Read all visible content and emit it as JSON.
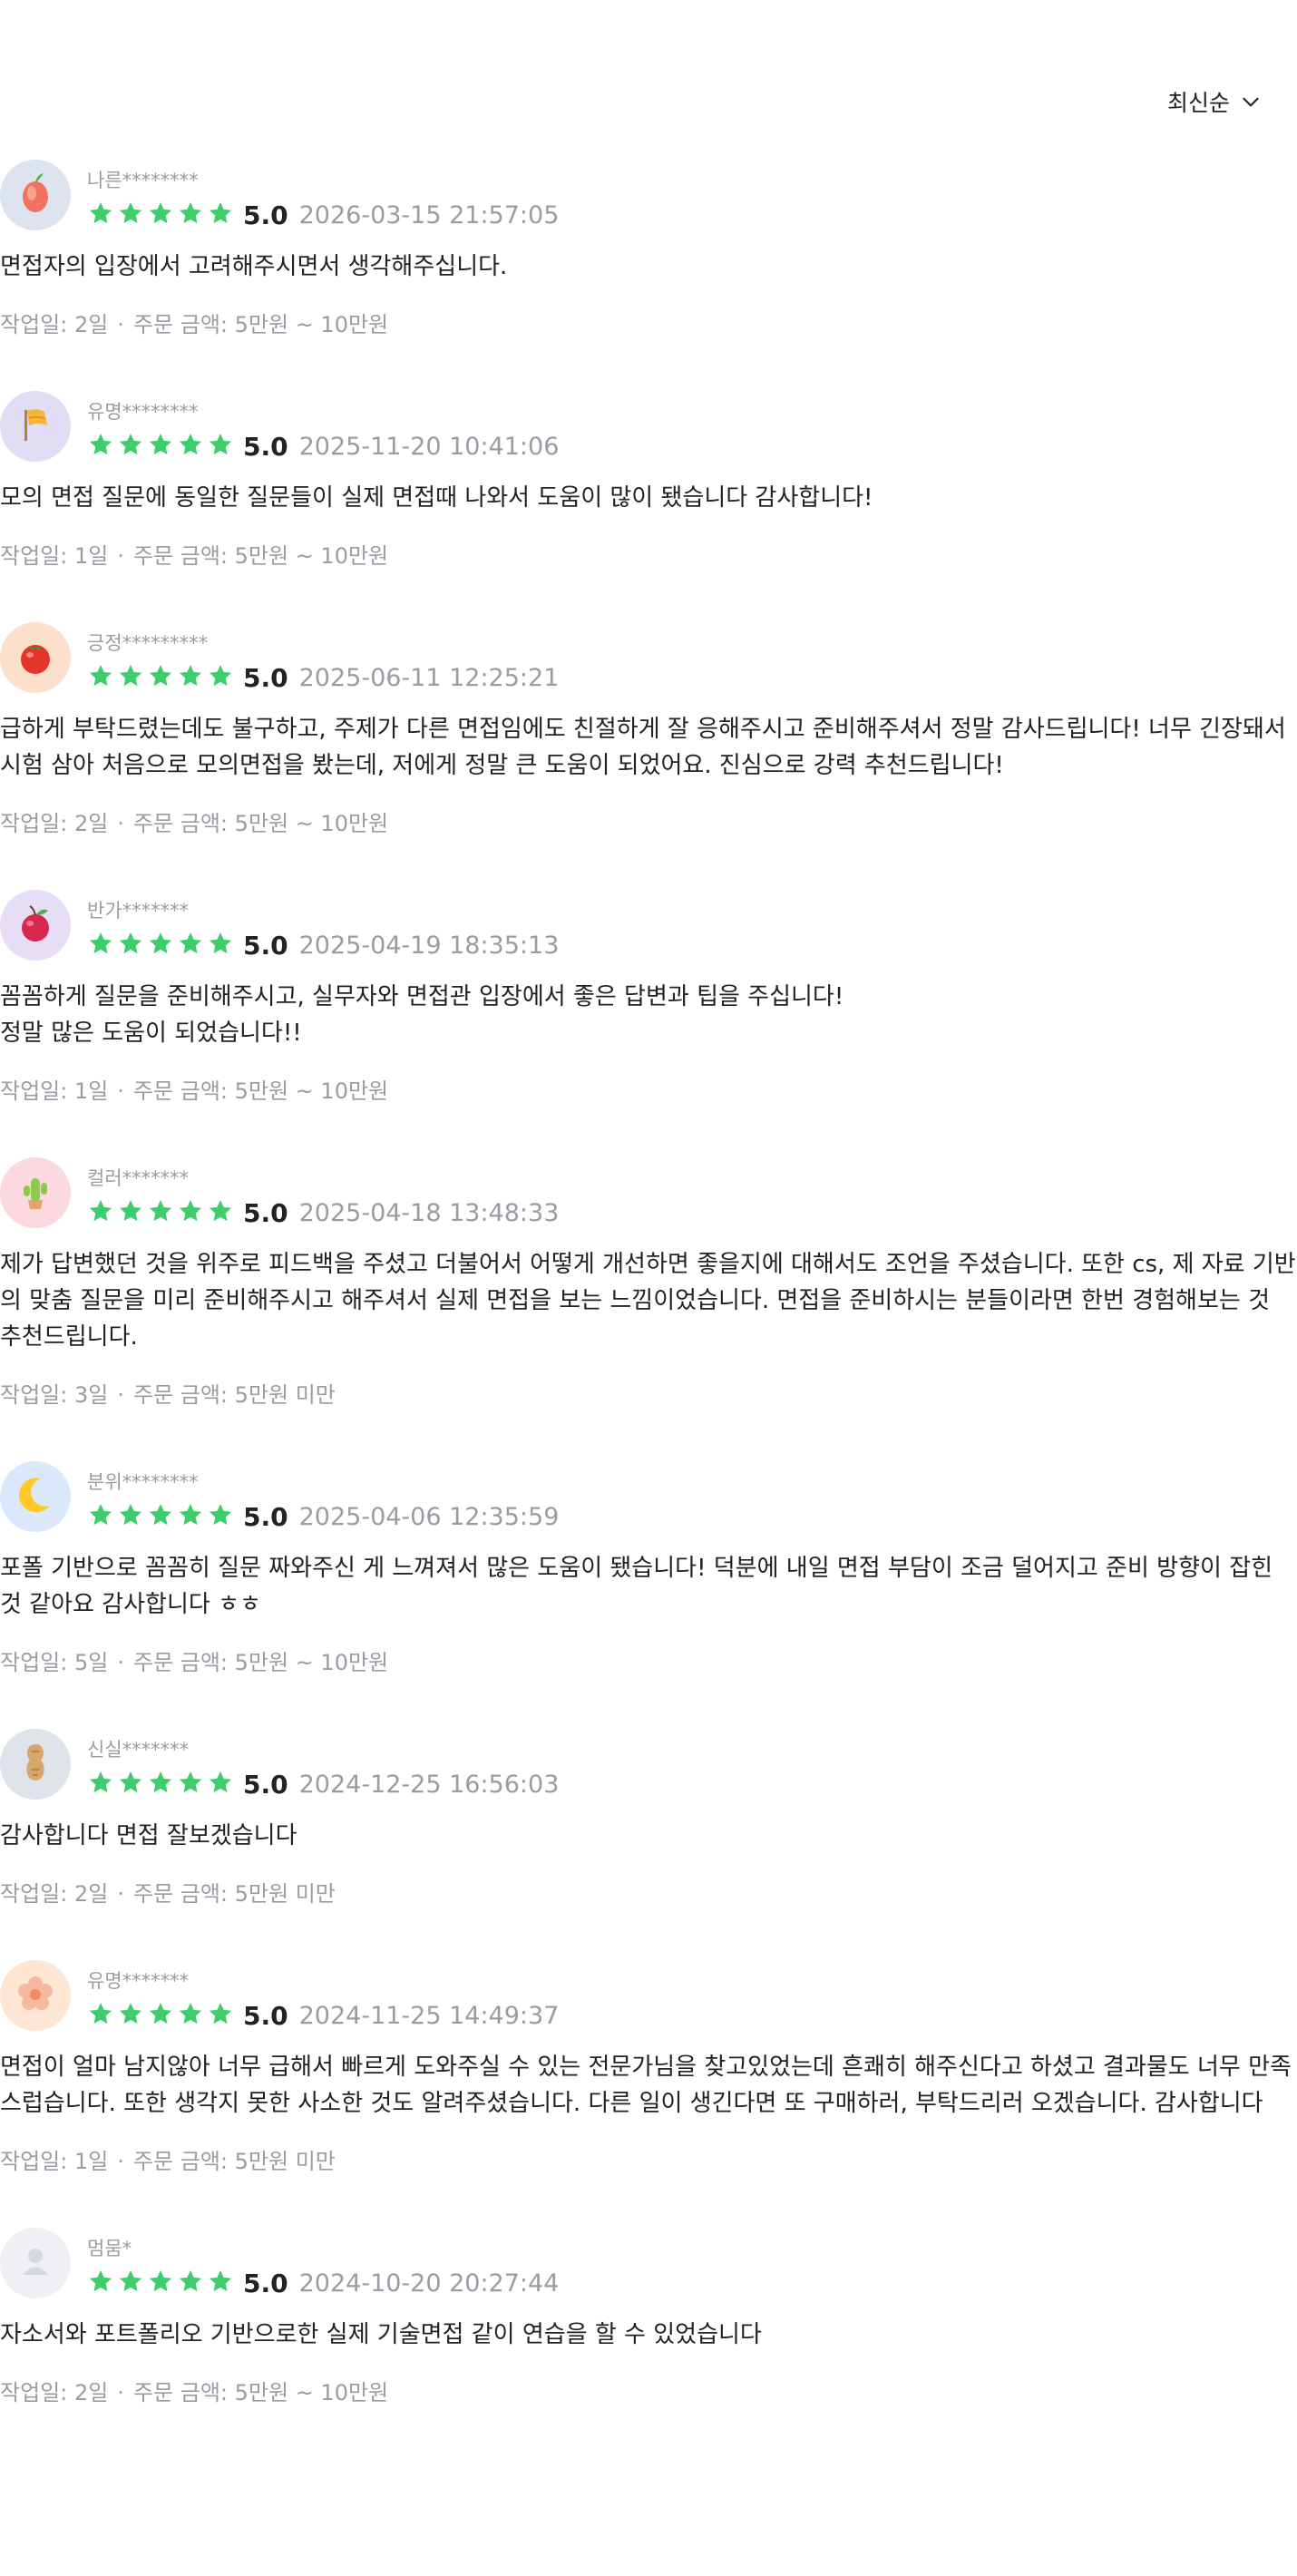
{
  "sort": {
    "label": "최신순"
  },
  "colors": {
    "star": "#3ecd6b",
    "muted": "#9a9ca3",
    "text": "#212224"
  },
  "labels": {
    "worktime_prefix": "작업일: ",
    "price_prefix": "주문 금액: ",
    "separator": "·"
  },
  "reviews": [
    {
      "avatar_icon": "guava-icon",
      "avatar_bg": "#dde4ef",
      "user": "나른********",
      "rating": "5.0",
      "stars": 5,
      "date": "2026-03-15 21:57:05",
      "text": "면접자의 입장에서 고려해주시면서 생각해주십니다.",
      "worktime": "2일",
      "price": "5만원 ~ 10만원"
    },
    {
      "avatar_icon": "flag-icon",
      "avatar_bg": "#e3dcf5",
      "user": "유명********",
      "rating": "5.0",
      "stars": 5,
      "date": "2025-11-20 10:41:06",
      "text": "모의 면접 질문에 동일한 질문들이 실제 면접때 나와서 도움이 많이 됐습니다 감사합니다!",
      "worktime": "1일",
      "price": "5만원 ~ 10만원"
    },
    {
      "avatar_icon": "tomato-icon",
      "avatar_bg": "#fde0cc",
      "user": "긍정*********",
      "rating": "5.0",
      "stars": 5,
      "date": "2025-06-11 12:25:21",
      "text": "급하게 부탁드렸는데도 불구하고, 주제가 다른 면접임에도 친절하게 잘 응해주시고 준비해주셔서 정말 감사드립니다! 너무 긴장돼서 시험 삼아 처음으로 모의면접을 봤는데, 저에게 정말 큰 도움이 되었어요. 진심으로 강력 추천드립니다!",
      "worktime": "2일",
      "price": "5만원 ~ 10만원"
    },
    {
      "avatar_icon": "apple-icon",
      "avatar_bg": "#e6ddf6",
      "user": "반가*******",
      "rating": "5.0",
      "stars": 5,
      "date": "2025-04-19 18:35:13",
      "text": "꼼꼼하게 질문을 준비해주시고, 실무자와 면접관 입장에서 좋은 답변과 팁을 주십니다!\n정말 많은 도움이 되었습니다!!",
      "worktime": "1일",
      "price": "5만원 ~ 10만원"
    },
    {
      "avatar_icon": "cactus-icon",
      "avatar_bg": "#fbd9de",
      "user": "컬러*******",
      "rating": "5.0",
      "stars": 5,
      "date": "2025-04-18 13:48:33",
      "text": "제가 답변했던 것을 위주로 피드백을 주셨고 더불어서 어떻게 개선하면 좋을지에 대해서도 조언을 주셨습니다. 또한 cs, 제 자료 기반의 맞춤 질문을 미리 준비해주시고 해주셔서 실제 면접을 보는 느낌이었습니다. 면접을 준비하시는 분들이라면 한번 경험해보는 것 추천드립니다.",
      "worktime": "3일",
      "price": "5만원 미만"
    },
    {
      "avatar_icon": "moon-icon",
      "avatar_bg": "#dbe8fb",
      "user": "분위********",
      "rating": "5.0",
      "stars": 5,
      "date": "2025-04-06 12:35:59",
      "text": "포폴 기반으로 꼼꼼히 질문 짜와주신 게 느껴져서 많은 도움이 됐습니다! 덕분에 내일 면접 부담이 조금 덜어지고 준비 방향이 잡힌 것 같아요 감사합니다 ㅎㅎ",
      "worktime": "5일",
      "price": "5만원 ~ 10만원"
    },
    {
      "avatar_icon": "peanut-icon",
      "avatar_bg": "#dfe3ea",
      "user": "신실*******",
      "rating": "5.0",
      "stars": 5,
      "date": "2024-12-25 16:56:03",
      "text": "감사합니다 면접 잘보겠습니다",
      "worktime": "2일",
      "price": "5만원 미만"
    },
    {
      "avatar_icon": "flower-icon",
      "avatar_bg": "#fde6d4",
      "user": "유명*******",
      "rating": "5.0",
      "stars": 5,
      "date": "2024-11-25 14:49:37",
      "text": "면접이 얼마 남지않아 너무 급해서 빠르게 도와주실 수 있는 전문가님을 찾고있었는데 흔쾌히 해주신다고 하셨고 결과물도 너무 만족스럽습니다. 또한 생각지 못한  사소한 것도 알려주셨습니다. 다른 일이 생긴다면 또 구매하러, 부탁드리러 오겠습니다. 감사합니다",
      "worktime": "1일",
      "price": "5만원 미만"
    },
    {
      "avatar_icon": "default-user-icon",
      "avatar_bg": "#eef0f4",
      "user": "멈뭄*",
      "rating": "5.0",
      "stars": 5,
      "date": "2024-10-20 20:27:44",
      "text": "자소서와 포트폴리오 기반으로한 실제 기술면접 같이 연습을 할 수 있었습니다",
      "worktime": "2일",
      "price": "5만원 ~ 10만원"
    }
  ]
}
